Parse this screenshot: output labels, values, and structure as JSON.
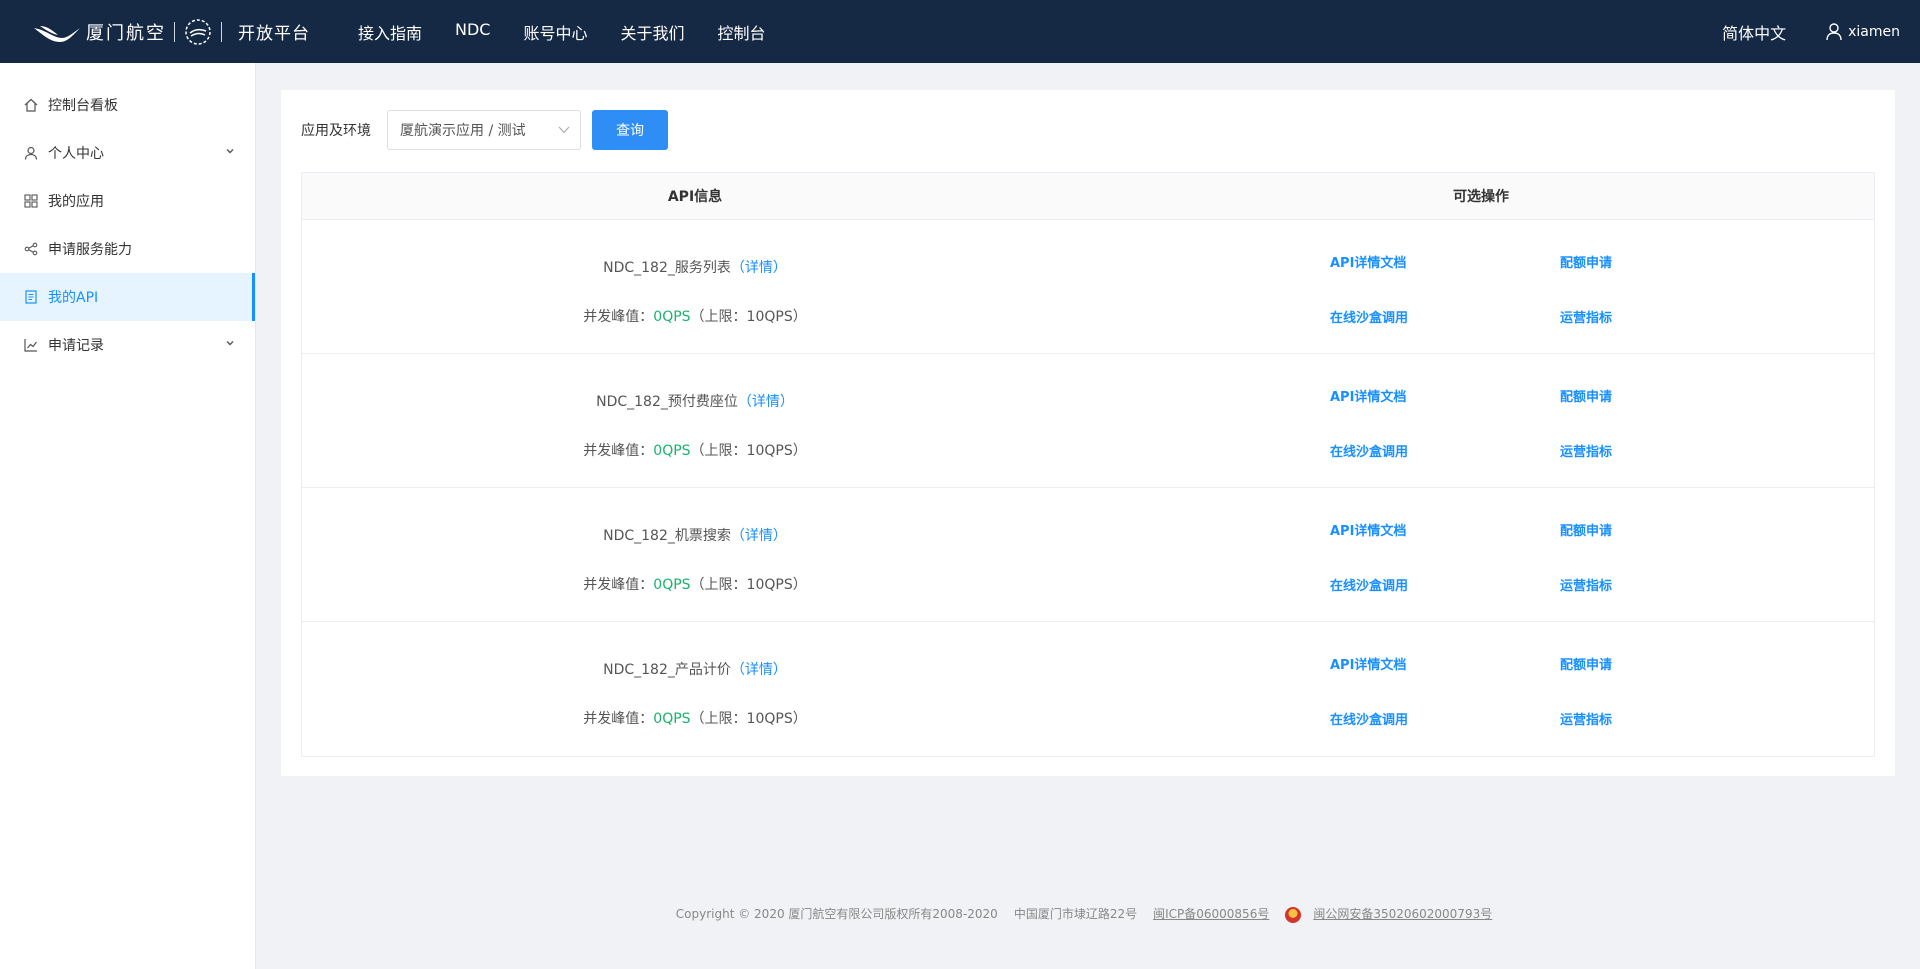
{
  "header": {
    "logo_text": "厦门航空",
    "logo_sub": "开放平台",
    "nav": [
      "接入指南",
      "NDC",
      "账号中心",
      "关于我们",
      "控制台"
    ],
    "lang": "简体中文",
    "user": "xiamen"
  },
  "sidebar": {
    "items": [
      {
        "label": "控制台看板",
        "icon": "home-icon"
      },
      {
        "label": "个人中心",
        "icon": "user-icon"
      },
      {
        "label": "我的应用",
        "icon": "grid-icon"
      },
      {
        "label": "申请服务能力",
        "icon": "share-icon"
      },
      {
        "label": "我的API",
        "icon": "document-icon"
      },
      {
        "label": "申请记录",
        "icon": "chart-line-icon"
      }
    ],
    "active": "我的API"
  },
  "filter": {
    "label": "应用及环境",
    "selected": "厦航演示应用 / 测试",
    "button": "查询"
  },
  "table": {
    "headers": [
      "API信息",
      "可选操作"
    ],
    "detail_link": "详情",
    "qps_prefix": "并发峰值：",
    "ops": [
      "API详情文档",
      "配额申请",
      "在线沙盒调用",
      "运营指标"
    ],
    "rows": [
      {
        "name": "NDC_182_服务列表",
        "qps": "0QPS",
        "limit": "（上限：10QPS）"
      },
      {
        "name": "NDC_182_预付费座位",
        "qps": "0QPS",
        "limit": "（上限：10QPS）"
      },
      {
        "name": "NDC_182_机票搜索",
        "qps": "0QPS",
        "limit": "（上限：10QPS）"
      },
      {
        "name": "NDC_182_产品计价",
        "qps": "0QPS",
        "limit": "（上限：10QPS）"
      }
    ]
  },
  "footer": {
    "copyright": "Copyright © 2020 厦门航空有限公司版权所有2008-2020",
    "address": "中国厦门市埭辽路22号",
    "icp": "闽ICP备06000856号",
    "police": "闽公网安备35020602000793号"
  },
  "colors": {
    "header_bg": "#152945",
    "accent": "#1890ff",
    "qps_green": "#19b36b"
  }
}
